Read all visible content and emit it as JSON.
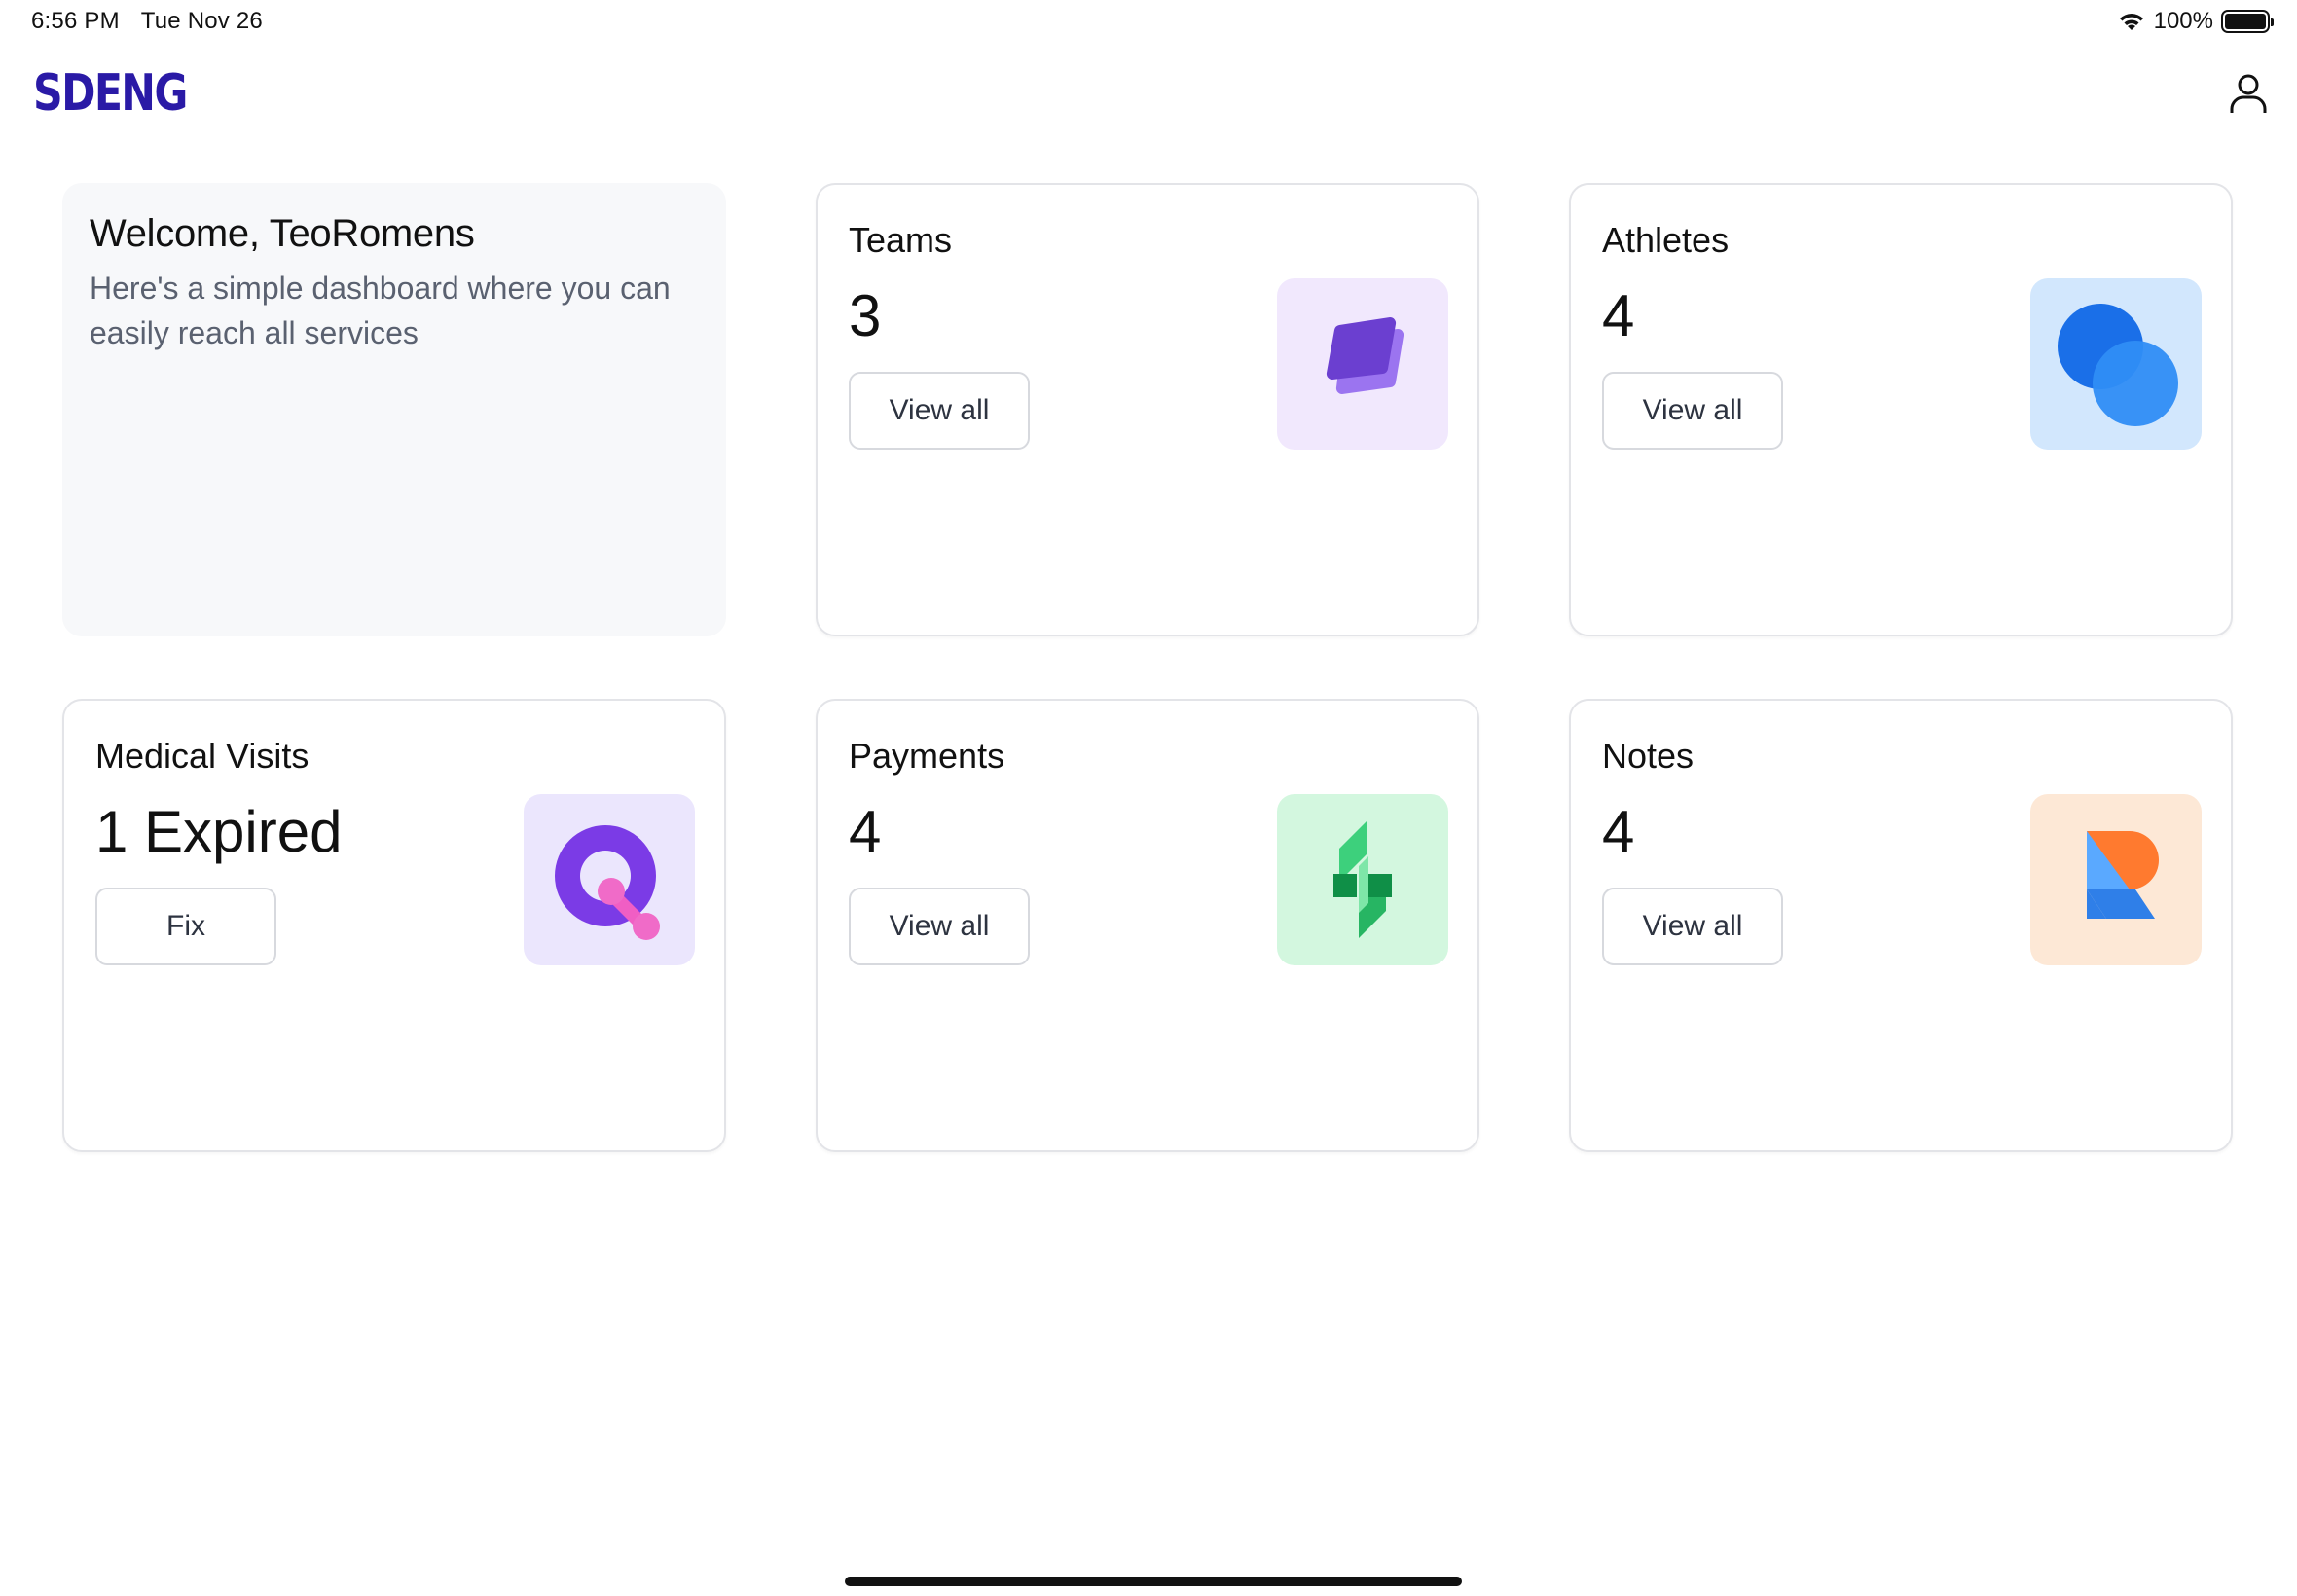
{
  "status_bar": {
    "time": "6:56 PM",
    "date": "Tue Nov 26",
    "battery": "100%",
    "battery_level": 1.0
  },
  "header": {
    "logo": "SDENG",
    "profile_icon": "user-icon"
  },
  "welcome": {
    "title": "Welcome, TeoRomens",
    "subtitle": "Here's a simple dashboard where you can easily reach all services"
  },
  "cards": [
    {
      "title": "Teams",
      "value": "3",
      "button": "View all",
      "icon": "layers-icon",
      "icon_bg": "#f1e8fd"
    },
    {
      "title": "Athletes",
      "value": "4",
      "button": "View all",
      "icon": "circles-icon",
      "icon_bg": "#d2e7fd"
    },
    {
      "title": "Medical Visits",
      "value": "1 Expired",
      "button": "Fix",
      "icon": "q-icon",
      "icon_bg": "#ebe6fd"
    },
    {
      "title": "Payments",
      "value": "4",
      "button": "View all",
      "icon": "bolt-icon",
      "icon_bg": "#d3f7df"
    },
    {
      "title": "Notes",
      "value": "4",
      "button": "View all",
      "icon": "r-icon",
      "icon_bg": "#fde8d6"
    }
  ],
  "colors": {
    "brand": "#2a1aa6",
    "card_border": "#e3e4e8",
    "welcome_bg": "#f7f8fa"
  }
}
